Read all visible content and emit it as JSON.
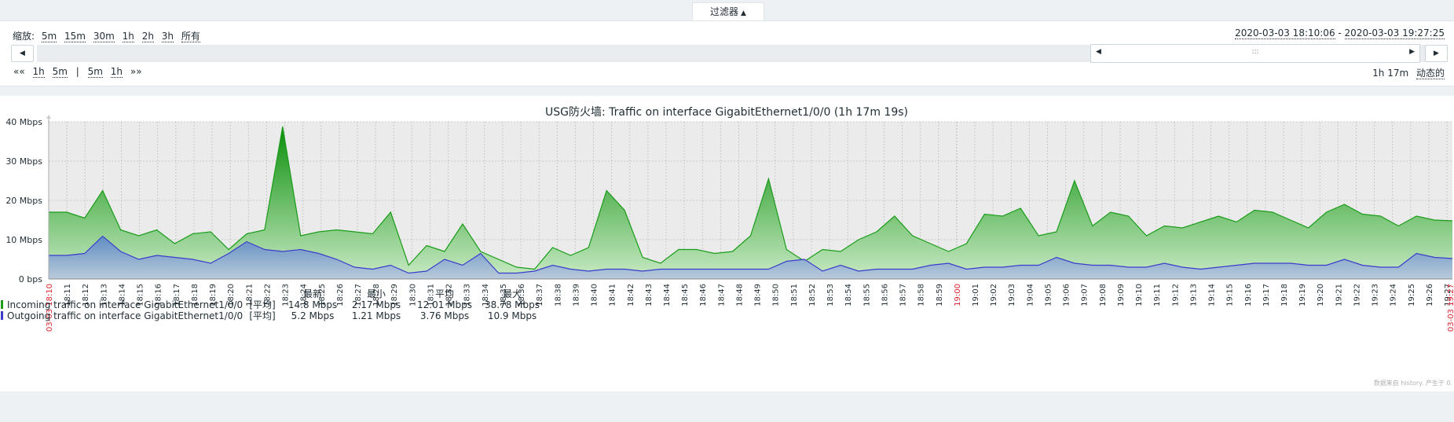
{
  "filter": {
    "label": "过滤器",
    "arrow": "▲"
  },
  "zoom": {
    "label": "缩放:",
    "options": [
      "5m",
      "15m",
      "30m",
      "1h",
      "2h",
      "3h",
      "所有"
    ]
  },
  "range": {
    "from": "2020-03-03 18:10:06",
    "separator": " - ",
    "to": "2020-03-03 19:27:25"
  },
  "nav": {
    "left": "◀",
    "right": "▶",
    "handle": ":::"
  },
  "step": {
    "back_all": "««",
    "back": [
      "1h",
      "5m"
    ],
    "sep": "|",
    "fwd": [
      "5m",
      "1h"
    ],
    "fwd_all": "»»"
  },
  "period": {
    "value": "1h 17m",
    "mode": "动态的"
  },
  "footer_note": "数据来自 history. 产生于 0.",
  "colors": {
    "incoming": "#1a9c1a",
    "outgoing": "#3c3ccc",
    "grid": "#c8c8c8",
    "plot_bg": "#ebebeb",
    "red": "#e0242f"
  },
  "chart_data": {
    "type": "area",
    "title": "USG防火墙: Traffic on interface GigabitEthernet1/0/0 (1h 17m 19s)",
    "ylabels": [
      "40 Mbps",
      "30 Mbps",
      "20 Mbps",
      "10 Mbps",
      "0 bps"
    ],
    "ylim": [
      0,
      40
    ],
    "xticks": [
      "18:11",
      "18:12",
      "18:13",
      "18:14",
      "18:15",
      "18:16",
      "18:17",
      "18:18",
      "18:19",
      "18:20",
      "18:21",
      "18:22",
      "18:23",
      "18:24",
      "18:25",
      "18:26",
      "18:27",
      "18:28",
      "18:29",
      "18:30",
      "18:31",
      "18:32",
      "18:33",
      "18:34",
      "18:35",
      "18:36",
      "18:37",
      "18:38",
      "18:39",
      "18:40",
      "18:41",
      "18:42",
      "18:43",
      "18:44",
      "18:45",
      "18:46",
      "18:47",
      "18:48",
      "18:49",
      "18:50",
      "18:51",
      "18:52",
      "18:53",
      "18:54",
      "18:55",
      "18:56",
      "18:57",
      "18:58",
      "18:59",
      "19:00",
      "19:01",
      "19:02",
      "19:03",
      "19:04",
      "19:05",
      "19:06",
      "19:07",
      "19:08",
      "19:09",
      "19:10",
      "19:11",
      "19:12",
      "19:13",
      "19:14",
      "19:15",
      "19:16",
      "19:17",
      "19:18",
      "19:19",
      "19:20",
      "19:21",
      "19:22",
      "19:23",
      "19:24",
      "19:25",
      "19:26",
      "19:27"
    ],
    "start_label": "03-03 18:10",
    "end_label": "03-03 19:27",
    "series": [
      {
        "name": "Incoming traffic on interface GigabitEthernet1/0/0",
        "values": [
          17,
          17,
          15.5,
          22.5,
          12.5,
          11,
          12.5,
          9,
          11.5,
          12,
          7.5,
          11.5,
          12.5,
          38.8,
          11,
          12,
          12.5,
          12,
          11.5,
          17,
          3.5,
          8.5,
          7,
          14,
          7,
          5,
          3,
          2.5,
          8,
          6,
          8,
          22.5,
          17.5,
          5.5,
          4,
          7.5,
          7.5,
          6.5,
          7,
          11,
          25.5,
          7.5,
          4.5,
          7.5,
          7,
          10,
          12,
          16,
          11,
          9,
          7,
          9,
          16.5,
          16,
          18,
          11,
          12,
          25,
          13.5,
          17,
          16,
          11,
          13.5,
          13,
          14.5,
          16,
          14.5,
          17.5,
          17,
          15,
          13,
          17,
          19,
          16.5,
          16,
          13.5,
          16,
          15,
          14.8
        ]
      },
      {
        "name": "Outgoing traffic on interface GigabitEthernet1/0/0",
        "values": [
          6,
          6,
          6.5,
          10.9,
          7,
          5,
          6,
          5.5,
          5,
          4,
          6.5,
          9.5,
          7.5,
          7,
          7.5,
          6.5,
          5,
          3,
          2.5,
          3.5,
          1.5,
          2,
          5,
          3.5,
          6.5,
          1.5,
          1.5,
          2,
          3.5,
          2.5,
          2,
          2.5,
          2.5,
          2,
          2.5,
          2.5,
          2.5,
          2.5,
          2.5,
          2.5,
          2.5,
          4.5,
          5,
          2,
          3.5,
          2,
          2.5,
          2.5,
          2.5,
          3.5,
          4,
          2.5,
          3,
          3,
          3.5,
          3.5,
          5.5,
          4,
          3.5,
          3.5,
          3,
          3,
          4,
          3,
          2.5,
          3,
          3.5,
          4,
          4,
          4,
          3.5,
          3.5,
          5,
          3.5,
          3,
          3,
          6.5,
          5.5,
          5.2
        ]
      }
    ],
    "legend": {
      "headers": [
        "最新",
        "最小",
        "平均",
        "最大"
      ],
      "func": "[平均]",
      "rows": [
        {
          "last": "14.8 Mbps",
          "min": "2.17 Mbps",
          "avg": "12.01 Mbps",
          "max": "38.78 Mbps"
        },
        {
          "last": "5.2 Mbps",
          "min": "1.21 Mbps",
          "avg": "3.76 Mbps",
          "max": "10.9 Mbps"
        }
      ]
    }
  }
}
